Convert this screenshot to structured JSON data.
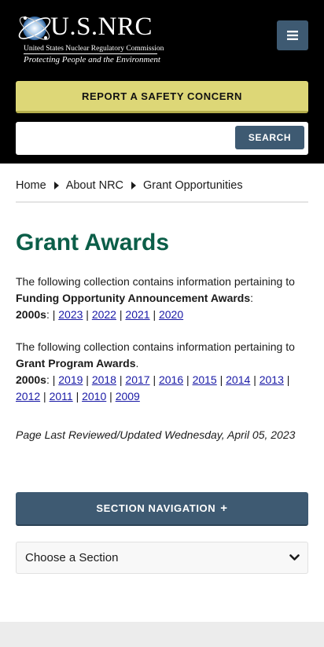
{
  "header": {
    "logo_main": "U.S.NRC",
    "logo_sub": "United States Nuclear Regulatory Commission",
    "logo_tagline": "Protecting People and the Environment",
    "menu_icon": "hamburger-icon",
    "report_label": "REPORT A SAFETY CONCERN",
    "search": {
      "placeholder": "",
      "value": "",
      "button_label": "SEARCH"
    },
    "colors": {
      "background": "#000000",
      "accent": "#3e5a72",
      "report": "#ddd777"
    }
  },
  "breadcrumb": {
    "items": [
      "Home",
      "About NRC",
      "Grant Opportunities"
    ],
    "separator_icon": "caret-right-icon"
  },
  "main": {
    "title": "Grant Awards",
    "title_color": "#0b5e48",
    "section1": {
      "intro": "The following collection contains information pertaining to",
      "bold": "Funding Opportunity Announcement Awards",
      "after_bold": ":",
      "decade_label": "2000s",
      "decade_suffix": ": |",
      "years": [
        "2023",
        "2022",
        "2021",
        "2020"
      ]
    },
    "section2": {
      "intro": "The following collection contains information pertaining to",
      "bold": "Grant Program Awards",
      "after_bold": ".",
      "decade_label": "2000s",
      "decade_suffix": ": |",
      "years": [
        "2019",
        "2018",
        "2017",
        "2016",
        "2015",
        "2014",
        "2013",
        "2012",
        "2011",
        "2010",
        "2009"
      ]
    },
    "reviewed": "Page Last Reviewed/Updated Wednesday, April 05, 2023"
  },
  "section_nav": {
    "label": "SECTION NAVIGATION",
    "plus": "+",
    "select_value": "Choose a Section",
    "select_icon": "chevron-down-icon"
  }
}
